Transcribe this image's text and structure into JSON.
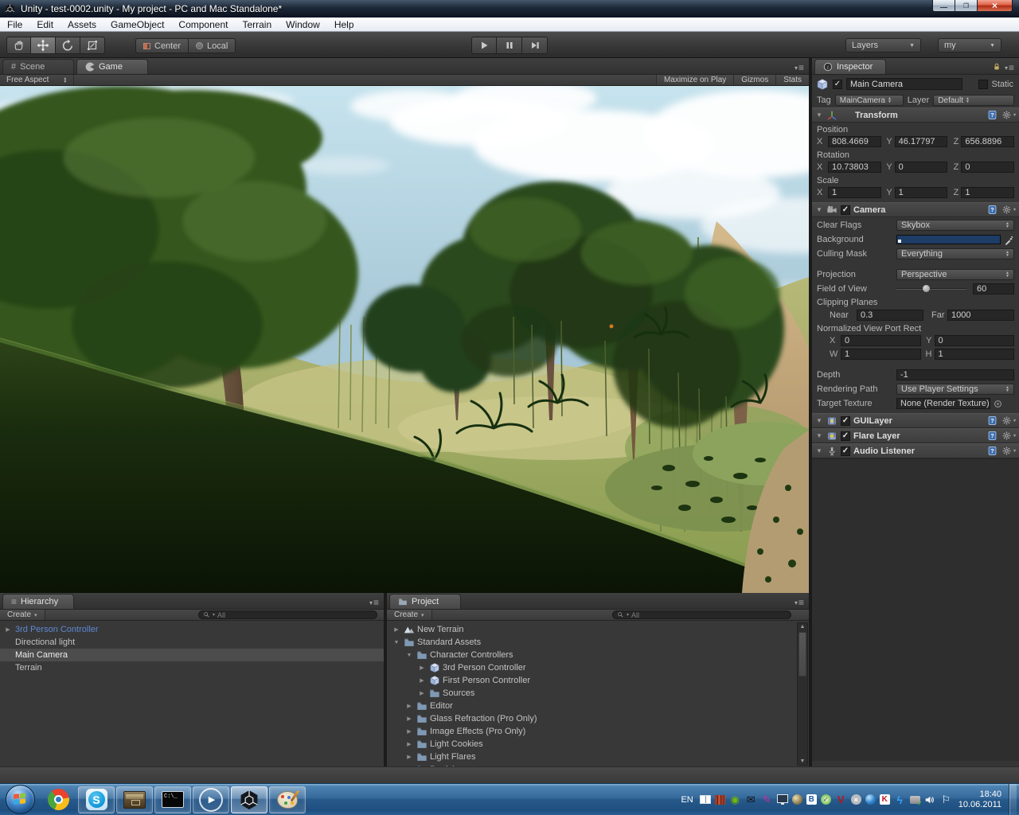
{
  "window": {
    "title": "Unity - test-0002.unity - My project - PC and Mac Standalone*"
  },
  "menu": {
    "items": [
      "File",
      "Edit",
      "Assets",
      "GameObject",
      "Component",
      "Terrain",
      "Window",
      "Help"
    ]
  },
  "toolbar": {
    "center": "Center",
    "local": "Local",
    "layers": "Layers",
    "layout": "my"
  },
  "game_panel": {
    "scene_tab": "Scene",
    "game_tab": "Game",
    "aspect": "Free Aspect",
    "maximize_on_play": "Maximize on Play",
    "gizmos": "Gizmos",
    "stats": "Stats"
  },
  "hierarchy": {
    "tab": "Hierarchy",
    "create": "Create",
    "search": "All",
    "items": [
      {
        "label": "3rd Person Controller"
      },
      {
        "label": "Directional light"
      },
      {
        "label": "Main Camera"
      },
      {
        "label": "Terrain"
      }
    ]
  },
  "project": {
    "tab": "Project",
    "create": "Create",
    "search": "All",
    "tree": [
      {
        "label": "New Terrain"
      },
      {
        "label": "Standard Assets"
      },
      {
        "label": "Character Controllers"
      },
      {
        "label": "3rd Person Controller"
      },
      {
        "label": "First Person Controller"
      },
      {
        "label": "Sources"
      },
      {
        "label": "Editor"
      },
      {
        "label": "Glass Refraction (Pro Only)"
      },
      {
        "label": "Image Effects (Pro Only)"
      },
      {
        "label": "Light Cookies"
      },
      {
        "label": "Light Flares"
      },
      {
        "label": "Particles"
      }
    ]
  },
  "inspector": {
    "tab": "Inspector",
    "object_name": "Main Camera",
    "static_label": "Static",
    "tag_label": "Tag",
    "tag_value": "MainCamera",
    "layer_label": "Layer",
    "layer_value": "Default",
    "transform": {
      "title": "Transform",
      "axis_x": "X",
      "axis_y": "Y",
      "axis_z": "Z",
      "sections": [
        {
          "label": "Position",
          "x": "808.4669",
          "y": "46.17797",
          "z": "656.8896"
        },
        {
          "label": "Rotation",
          "x": "10.73803",
          "y": "0",
          "z": "0"
        },
        {
          "label": "Scale",
          "x": "1",
          "y": "1",
          "z": "1"
        }
      ]
    },
    "camera": {
      "title": "Camera",
      "clear_flags_label": "Clear Flags",
      "clear_flags_value": "Skybox",
      "background_label": "Background",
      "culling_mask_label": "Culling Mask",
      "culling_mask_value": "Everything",
      "projection_label": "Projection",
      "projection_value": "Perspective",
      "fov_label": "Field of View",
      "fov_value": "60",
      "clipping_label": "Clipping Planes",
      "near_label": "Near",
      "near_value": "0.3",
      "far_label": "Far",
      "far_value": "1000",
      "viewport_label": "Normalized View Port Rect",
      "vp_x_label": "X",
      "vp_x": "0",
      "vp_y_label": "Y",
      "vp_y": "0",
      "vp_w_label": "W",
      "vp_w": "1",
      "vp_h_label": "H",
      "vp_h": "1",
      "depth_label": "Depth",
      "depth_value": "-1",
      "rendering_path_label": "Rendering Path",
      "rendering_path_value": "Use Player Settings",
      "target_texture_label": "Target Texture",
      "target_texture_value": "None (Render Texture)"
    },
    "components": [
      {
        "name": "GUILayer"
      },
      {
        "name": "Flare Layer"
      },
      {
        "name": "Audio Listener"
      }
    ]
  },
  "taskbar": {
    "language": "EN",
    "time": "18:40",
    "date": "10.06.2011",
    "apps": [
      "start",
      "chrome",
      "skype",
      "file-manager",
      "command-prompt",
      "media-player",
      "unity",
      "paint"
    ],
    "tray_icons": [
      "window-panes",
      "books",
      "nvidia",
      "mail",
      "pencil",
      "monitor",
      "cd",
      "bing",
      "badge",
      "antivirus-v",
      "offline-x",
      "globe",
      "kaspersky",
      "lightning",
      "usb",
      "volume",
      "action-center-flag"
    ]
  },
  "palette": {
    "taskbar_blue": "#2e6496",
    "unity_panel": "#383838",
    "selection_gray": "#4c4c4c",
    "prefab_blue": "#5e87d2",
    "sky_top": "#c2e0ec",
    "foreground_grass": "#16250c",
    "sand": "#c2a277",
    "camera_background_swatch": "#1d3c66"
  }
}
